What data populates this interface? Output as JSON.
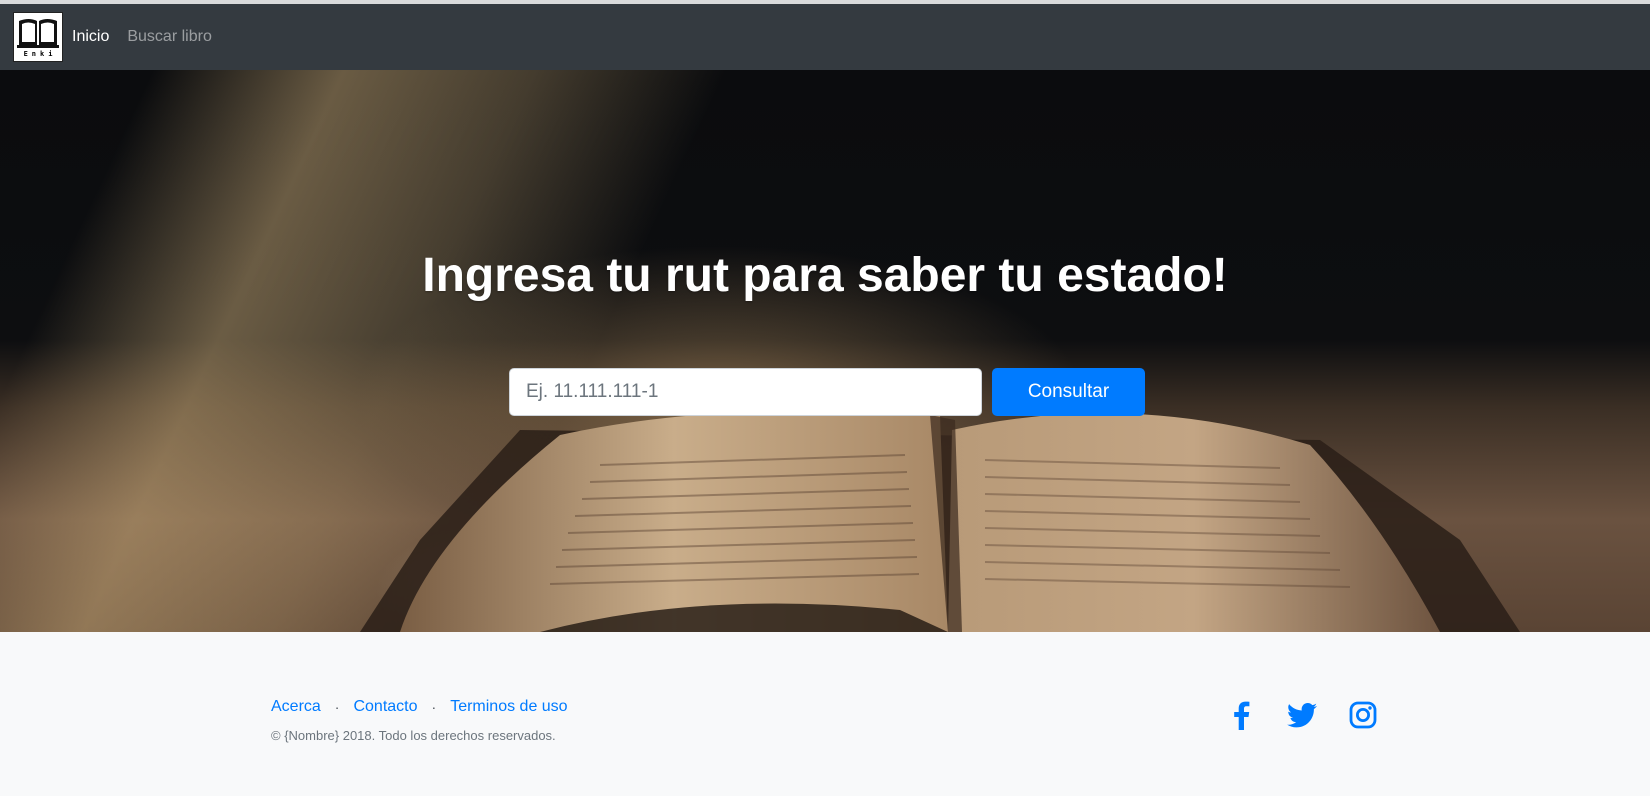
{
  "navbar": {
    "brand_text": "Enki",
    "links": [
      {
        "label": "Inicio",
        "active": true
      },
      {
        "label": "Buscar libro",
        "active": false
      }
    ]
  },
  "hero": {
    "title": "Ingresa tu rut para saber tu estado!",
    "input_placeholder": "Ej. 11.111.111-1",
    "submit_label": "Consultar"
  },
  "footer": {
    "links": [
      "Acerca",
      "Contacto",
      "Terminos de uso"
    ],
    "separator": "·",
    "copyright": "© {Nombre} 2018. Todo los derechos reservados.",
    "social": [
      "facebook-icon",
      "twitter-icon",
      "instagram-icon"
    ]
  },
  "colors": {
    "navbar_bg": "#343a40",
    "primary": "#007bff",
    "footer_bg": "#f8f9fa"
  }
}
